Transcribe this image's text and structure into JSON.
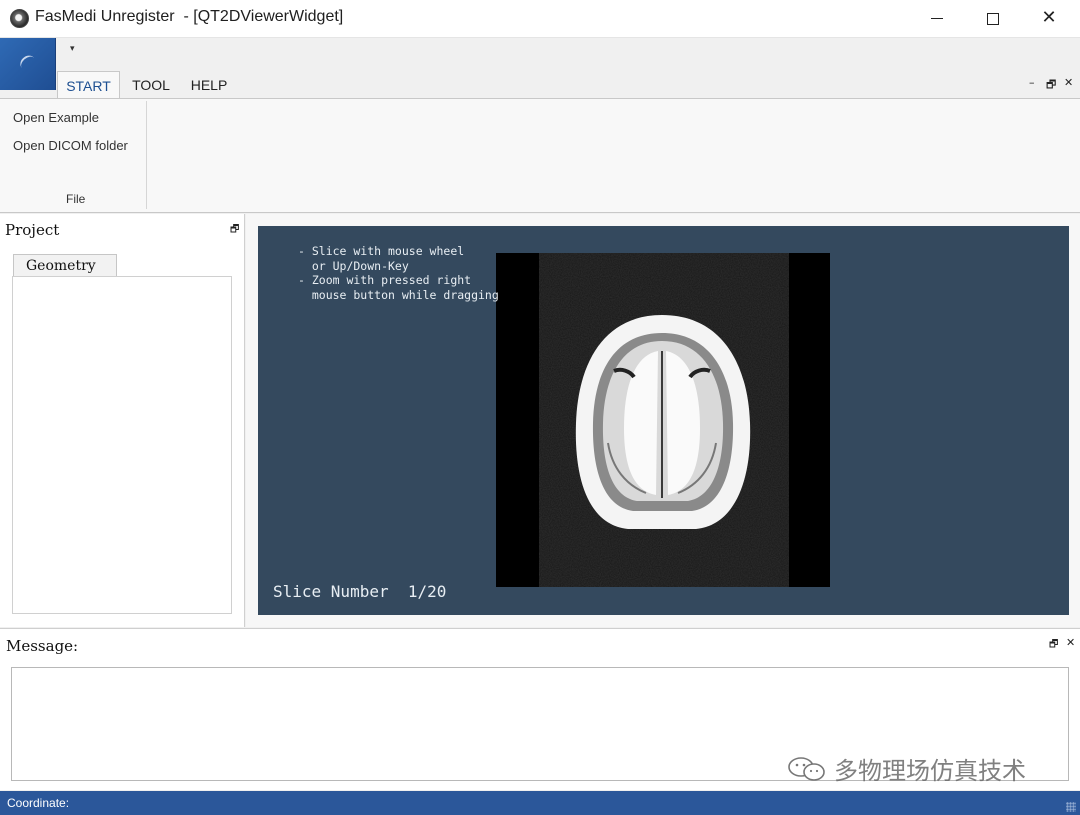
{
  "window": {
    "title": "FasMedi Unregister  - [QT2DViewerWidget]",
    "minimize_glyph": "",
    "maximize_glyph": "",
    "close_glyph": "✕"
  },
  "ribbon": {
    "quick_access_glyph": "▾",
    "tabs": [
      {
        "label": "START",
        "active": true
      },
      {
        "label": "TOOL",
        "active": false
      },
      {
        "label": "HELP",
        "active": false
      }
    ],
    "controls": {
      "minimize": "–",
      "restore": "🗗",
      "close": "✕"
    },
    "groups": [
      {
        "label": "File",
        "items": [
          "Open Example",
          "Open DICOM folder"
        ]
      }
    ]
  },
  "project_dock": {
    "title": "Project",
    "float_glyph": "🗗",
    "tab_label": "Geometry"
  },
  "viewer": {
    "instructions": "- Slice with mouse wheel\n  or Up/Down-Key\n- Zoom with pressed right\n  mouse button while dragging",
    "slice_number": "Slice Number  1/20",
    "background_color": "#34495e"
  },
  "message_dock": {
    "title": "Message:",
    "float_glyph": "🗗",
    "close_glyph": "✕",
    "watermark": "多物理场仿真技术"
  },
  "statusbar": {
    "text": "Coordinate:"
  },
  "colors": {
    "accent": "#2b579a",
    "active_tab_text": "#1d4f91"
  }
}
